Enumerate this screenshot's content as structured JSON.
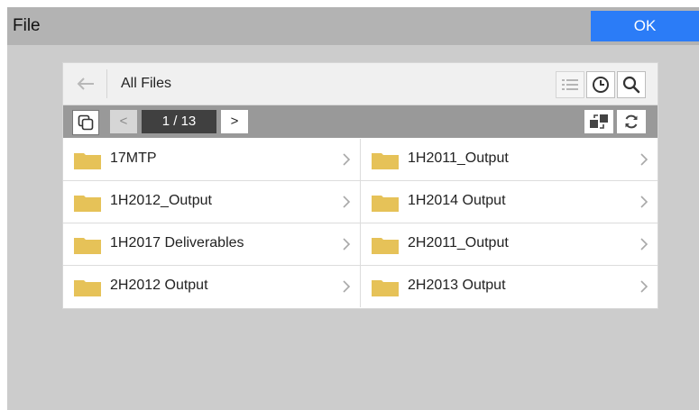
{
  "window": {
    "title": "File",
    "ok_label": "OK"
  },
  "colors": {
    "accent": "#2b7cf7",
    "folder": "#e6c258",
    "titlebar": "#b3b3b3",
    "pager_bar": "#999999"
  },
  "header": {
    "back_icon": "arrow-left-icon",
    "title": "All Files",
    "view_buttons": [
      "list-view-icon",
      "clock-icon",
      "search-icon"
    ]
  },
  "pager": {
    "prev_label": "<",
    "page_text": "1 / 13",
    "next_label": ">",
    "left_tool_icon": "multi-select-icon",
    "right_tool_icons": [
      "move-icon",
      "refresh-icon"
    ]
  },
  "folders": [
    {
      "name": "17MTP",
      "icon": "folder-icon"
    },
    {
      "name": "1H2011_Output",
      "icon": "folder-icon"
    },
    {
      "name": "1H2012_Output",
      "icon": "folder-icon"
    },
    {
      "name": "1H2014 Output",
      "icon": "folder-icon"
    },
    {
      "name": "1H2017 Deliverables",
      "icon": "folder-icon"
    },
    {
      "name": "2H2011_Output",
      "icon": "folder-icon"
    },
    {
      "name": "2H2012 Output",
      "icon": "folder-icon"
    },
    {
      "name": "2H2013 Output",
      "icon": "folder-icon"
    }
  ]
}
